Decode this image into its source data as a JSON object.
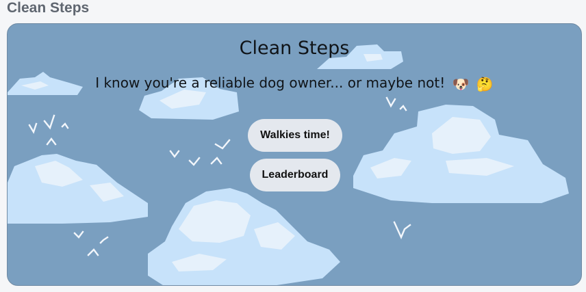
{
  "page": {
    "header": "Clean Steps"
  },
  "card": {
    "title": "Clean Steps",
    "subtitle": "I know you're a reliable dog owner... or maybe not!",
    "emoji_dog": "🐶",
    "emoji_thinking": "🤔",
    "buttons": {
      "walkies": "Walkies time!",
      "leaderboard": "Leaderboard"
    }
  },
  "colors": {
    "sky": "#7a9fc0",
    "cloud_light": "#c7e2fa",
    "cloud_highlight": "#e6f1fb",
    "button_bg": "#e4e8ee"
  }
}
